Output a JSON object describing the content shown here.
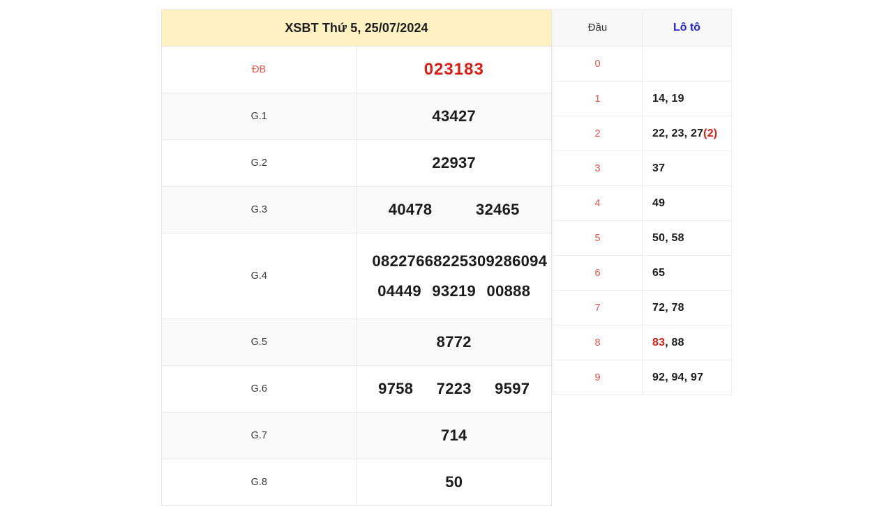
{
  "header": {
    "title": "XSBT Thứ 5, 25/07/2024"
  },
  "prize_table": {
    "rows": [
      {
        "label": "ĐB",
        "values": [
          "023183"
        ],
        "lines": 1,
        "highlight": true
      },
      {
        "label": "G.1",
        "values": [
          "43427"
        ],
        "lines": 1,
        "highlight": false
      },
      {
        "label": "G.2",
        "values": [
          "22937"
        ],
        "lines": 1,
        "highlight": false
      },
      {
        "label": "G.3",
        "values": [
          "40478",
          "32465"
        ],
        "lines": 1,
        "highlight": false
      },
      {
        "label": "G.4",
        "values": [
          "08227",
          "66822",
          "53092",
          "86094",
          "04449",
          "93219",
          "00888"
        ],
        "lines": 2,
        "highlight": false
      },
      {
        "label": "G.5",
        "values": [
          "8772"
        ],
        "lines": 1,
        "highlight": false
      },
      {
        "label": "G.6",
        "values": [
          "9758",
          "7223",
          "9597"
        ],
        "lines": 1,
        "highlight": false
      },
      {
        "label": "G.7",
        "values": [
          "714"
        ],
        "lines": 1,
        "highlight": false
      },
      {
        "label": "G.8",
        "values": [
          "50"
        ],
        "lines": 1,
        "highlight": false
      }
    ],
    "cells": {
      "db_label": "ĐB",
      "db_value": "023183",
      "g1_label": "G.1",
      "g1_value": "43427",
      "g2_label": "G.2",
      "g2_value": "22937",
      "g3_label": "G.3",
      "g3_v1": "40478",
      "g3_v2": "32465",
      "g4_label": "G.4",
      "g4_v1": "08227",
      "g4_v2": "66822",
      "g4_v3": "53092",
      "g4_v4": "86094",
      "g4_v5": "04449",
      "g4_v6": "93219",
      "g4_v7": "00888",
      "g5_label": "G.5",
      "g5_value": "8772",
      "g6_label": "G.6",
      "g6_v1": "9758",
      "g6_v2": "7223",
      "g6_v3": "9597",
      "g7_label": "G.7",
      "g7_value": "714",
      "g8_label": "G.8",
      "g8_value": "50"
    }
  },
  "loto_table": {
    "columns": {
      "head": "Đầu",
      "values": "Lô tô"
    },
    "rows": [
      {
        "head": "0",
        "text": ""
      },
      {
        "head": "1",
        "text": "14, 19"
      },
      {
        "head": "2",
        "text": "22, 23, 27(2)"
      },
      {
        "head": "3",
        "text": "37"
      },
      {
        "head": "4",
        "text": "49"
      },
      {
        "head": "5",
        "text": "50, 58"
      },
      {
        "head": "6",
        "text": "65"
      },
      {
        "head": "7",
        "text": "72, 78"
      },
      {
        "head": "8",
        "text": "83, 88"
      },
      {
        "head": "9",
        "text": "92, 94, 97"
      }
    ],
    "cells": {
      "d0": "0",
      "v0": "",
      "d1": "1",
      "v1": "14, 19",
      "d2": "2",
      "v2a": "22, 23, 27",
      "v2b": "(2)",
      "d3": "3",
      "v3": "37",
      "d4": "4",
      "v4": "49",
      "d5": "5",
      "v5": "50, 58",
      "d6": "6",
      "v6": "65",
      "d7": "7",
      "v7": "72, 78",
      "d8": "8",
      "v8a": "83",
      "v8b": ", 88",
      "d9": "9",
      "v9": "92, 94, 97"
    }
  },
  "colors": {
    "header_bg": "#FDF1C2",
    "special_red": "#DD1C13",
    "label_red": "#E4554D",
    "loto_blue": "#2020DD",
    "stripe_bg": "#F9F9F9",
    "loto_head_bg": "#F8F8F8",
    "border": "#E8E8E8",
    "text": "#1B1B1B",
    "page_bg": "#FFFFFF"
  }
}
